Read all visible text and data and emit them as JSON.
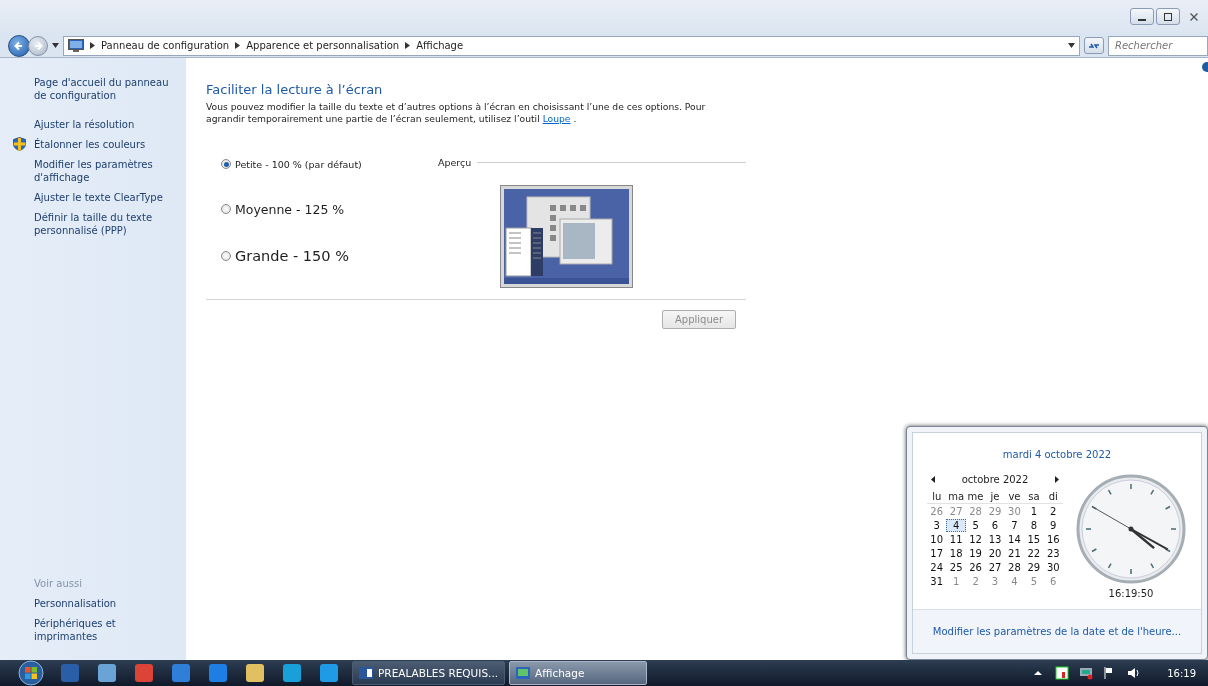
{
  "address_bar": {
    "breadcrumbs": [
      "Panneau de configuration",
      "Apparence et personnalisation",
      "Affichage"
    ],
    "search": {
      "placeholder": "Rechercher"
    }
  },
  "sidebar": {
    "items": [
      {
        "label": "Page d'accueil du panneau de configuration",
        "kind": "plain"
      },
      {
        "label": "Ajuster la résolution",
        "kind": "plain"
      },
      {
        "label": "Étalonner les couleurs",
        "kind": "shield"
      },
      {
        "label": "Modifier les paramètres d'affichage",
        "kind": "plain"
      },
      {
        "label": "Ajuster le texte ClearType",
        "kind": "plain"
      },
      {
        "label": "Définir la taille du texte personnalisé (PPP)",
        "kind": "plain"
      }
    ],
    "see_also": {
      "title": "Voir aussi",
      "items": [
        "Personnalisation",
        "Périphériques et imprimantes"
      ]
    }
  },
  "main": {
    "heading": "Faciliter la lecture à l’écran",
    "description": "Vous pouvez modifier la taille du texte et d’autres options à l’écran en choisissant l’une de ces options. Pour agrandir temporairement une partie de l’écran seulement, utilisez l’outil",
    "link": "Loupe",
    "description_end": ".",
    "options": [
      {
        "label": "Petite - 100 % (par défaut)",
        "kind": "small",
        "selected": true
      },
      {
        "label": "Moyenne - 125 %",
        "kind": "medium",
        "selected": false
      },
      {
        "label": "Grande - 150 %",
        "kind": "large",
        "selected": false
      }
    ],
    "preview_label": "Aperçu",
    "apply_button": {
      "label": "Appliquer",
      "disabled": true
    }
  },
  "calendar_popup": {
    "date_header": "mardi 4 octobre 2022",
    "month": "octobre 2022",
    "weekdays": [
      "lu",
      "ma",
      "me",
      "je",
      "ve",
      "sa",
      "di"
    ],
    "weeks": [
      [
        {
          "day": "26",
          "other_month": true,
          "selected": false
        },
        {
          "day": "27",
          "other_month": true,
          "selected": false
        },
        {
          "day": "28",
          "other_month": true,
          "selected": false
        },
        {
          "day": "29",
          "other_month": true,
          "selected": false
        },
        {
          "day": "30",
          "other_month": true,
          "selected": false
        },
        {
          "day": "1",
          "other_month": false,
          "selected": false
        },
        {
          "day": "2",
          "other_month": false,
          "selected": false
        }
      ],
      [
        {
          "day": "3",
          "other_month": false,
          "selected": false
        },
        {
          "day": "4",
          "other_month": false,
          "selected": true
        },
        {
          "day": "5",
          "other_month": false,
          "selected": false
        },
        {
          "day": "6",
          "other_month": false,
          "selected": false
        },
        {
          "day": "7",
          "other_month": false,
          "selected": false
        },
        {
          "day": "8",
          "other_month": false,
          "selected": false
        },
        {
          "day": "9",
          "other_month": false,
          "selected": false
        }
      ],
      [
        {
          "day": "10",
          "other_month": false,
          "selected": false
        },
        {
          "day": "11",
          "other_month": false,
          "selected": false
        },
        {
          "day": "12",
          "other_month": false,
          "selected": false
        },
        {
          "day": "13",
          "other_month": false,
          "selected": false
        },
        {
          "day": "14",
          "other_month": false,
          "selected": false
        },
        {
          "day": "15",
          "other_month": false,
          "selected": false
        },
        {
          "day": "16",
          "other_month": false,
          "selected": false
        }
      ],
      [
        {
          "day": "17",
          "other_month": false,
          "selected": false
        },
        {
          "day": "18",
          "other_month": false,
          "selected": false
        },
        {
          "day": "19",
          "other_month": false,
          "selected": false
        },
        {
          "day": "20",
          "other_month": false,
          "selected": false
        },
        {
          "day": "21",
          "other_month": false,
          "selected": false
        },
        {
          "day": "22",
          "other_month": false,
          "selected": false
        },
        {
          "day": "23",
          "other_month": false,
          "selected": false
        }
      ],
      [
        {
          "day": "24",
          "other_month": false,
          "selected": false
        },
        {
          "day": "25",
          "other_month": false,
          "selected": false
        },
        {
          "day": "26",
          "other_month": false,
          "selected": false
        },
        {
          "day": "27",
          "other_month": false,
          "selected": false
        },
        {
          "day": "28",
          "other_month": false,
          "selected": false
        },
        {
          "day": "29",
          "other_month": false,
          "selected": false
        },
        {
          "day": "30",
          "other_month": false,
          "selected": false
        }
      ],
      [
        {
          "day": "31",
          "other_month": false,
          "selected": false
        },
        {
          "day": "1",
          "other_month": true,
          "selected": false
        },
        {
          "day": "2",
          "other_month": true,
          "selected": false
        },
        {
          "day": "3",
          "other_month": true,
          "selected": false
        },
        {
          "day": "4",
          "other_month": true,
          "selected": false
        },
        {
          "day": "5",
          "other_month": true,
          "selected": false
        },
        {
          "day": "6",
          "other_month": true,
          "selected": false
        }
      ]
    ],
    "time": "16:19:50",
    "link": "Modifier les paramètres de la date et de l'heure..."
  },
  "taskbar": {
    "windows": [
      {
        "label": "PREALABLES REQUIS...",
        "kind": "word",
        "active": false
      },
      {
        "label": "Affichage",
        "kind": "display",
        "active": true
      }
    ],
    "clock": "16:19"
  }
}
